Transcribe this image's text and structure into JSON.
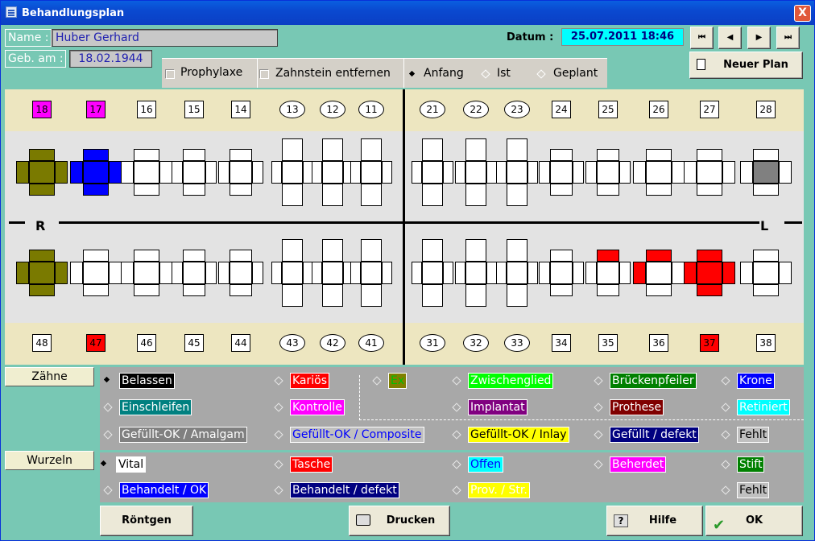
{
  "window": {
    "title": "Behandlungsplan",
    "close": "X"
  },
  "patient": {
    "name_label": "Name :",
    "name": "Huber Gerhard",
    "dob_label": "Geb. am :",
    "dob": "18.02.1944"
  },
  "datum": {
    "label": "Datum :",
    "value": "25.07.2011 18:46"
  },
  "nav": {
    "first": "⏮",
    "prev": "◀",
    "next": "▶",
    "last": "⏭"
  },
  "new_plan": "Neuer Plan",
  "options": {
    "prophylaxe": "Prophylaxe",
    "zahnstein": "Zahnstein entfernen",
    "anfang": "Anfang",
    "ist": "Ist",
    "geplant": "Geplant",
    "selected": "Anfang"
  },
  "side": {
    "r": "R",
    "l": "L"
  },
  "teeth_upper": [
    "18",
    "17",
    "16",
    "15",
    "14",
    "13",
    "12",
    "11",
    "21",
    "22",
    "23",
    "24",
    "25",
    "26",
    "27",
    "28"
  ],
  "teeth_lower": [
    "48",
    "47",
    "46",
    "45",
    "44",
    "43",
    "42",
    "41",
    "31",
    "32",
    "33",
    "34",
    "35",
    "36",
    "37",
    "38"
  ],
  "colors": {
    "olive": "#7a7a00",
    "blue": "#0000ff",
    "red": "#ff0000",
    "magenta": "#ff00ff",
    "gray": "#808080"
  },
  "buttons": {
    "zaehne": "Zähne",
    "wurzeln": "Wurzeln",
    "roentgen": "Röntgen",
    "drucken": "Drucken",
    "hilfe": "Hilfe",
    "ok": "OK"
  },
  "legend_teeth": [
    {
      "label": "Belassen",
      "bg": "#000000",
      "fg": "#ffffff",
      "on": true
    },
    {
      "label": "Kariös",
      "bg": "#ff0000",
      "fg": "#ffffff"
    },
    {
      "label": "Ex",
      "bg": "#808000",
      "fg": "#00c000"
    },
    {
      "label": "Zwischenglied",
      "bg": "#00ff00",
      "fg": "#ffffff"
    },
    {
      "label": "Brückenpfeiler",
      "bg": "#008000",
      "fg": "#ffffff"
    },
    {
      "label": "Krone",
      "bg": "#0000ff",
      "fg": "#ffffff"
    },
    {
      "label": "Einschleifen",
      "bg": "#008080",
      "fg": "#ffffff"
    },
    {
      "label": "Kontrolle",
      "bg": "#ff00ff",
      "fg": "#ffffff"
    },
    {
      "label": "Implantat",
      "bg": "#800080",
      "fg": "#ffffff"
    },
    {
      "label": "Prothese",
      "bg": "#800000",
      "fg": "#ffffff"
    },
    {
      "label": "Retiniert",
      "bg": "#00ffff",
      "fg": "#ffffff"
    },
    {
      "label": "Gefüllt-OK / Amalgam",
      "bg": "#808080",
      "fg": "#ffffff"
    },
    {
      "label": "Gefüllt-OK / Composite",
      "bg": "#c0c0c0",
      "fg": "#0000ff"
    },
    {
      "label": "Gefüllt-OK / Inlay",
      "bg": "#ffff00",
      "fg": "#000000"
    },
    {
      "label": "Gefüllt / defekt",
      "bg": "#000080",
      "fg": "#ffffff"
    },
    {
      "label": "Fehlt",
      "bg": "#c0c0c0",
      "fg": "#000000"
    }
  ],
  "legend_roots": [
    {
      "label": "Vital",
      "bg": "#ffffff",
      "fg": "#000000",
      "on": true
    },
    {
      "label": "Tasche",
      "bg": "#ff0000",
      "fg": "#ffffff"
    },
    {
      "label": "Offen",
      "bg": "#00ffff",
      "fg": "#0000ff"
    },
    {
      "label": "Beherdet",
      "bg": "#ff00ff",
      "fg": "#ffffff"
    },
    {
      "label": "Stift",
      "bg": "#008000",
      "fg": "#ffffff"
    },
    {
      "label": "Behandelt / OK",
      "bg": "#0000ff",
      "fg": "#ffffff"
    },
    {
      "label": "Behandelt / defekt",
      "bg": "#000080",
      "fg": "#ffffff"
    },
    {
      "label": "Prov. / Str.",
      "bg": "#ffff00",
      "fg": "#ffffff"
    },
    {
      "label": "Fehlt",
      "bg": "#c0c0c0",
      "fg": "#000000"
    }
  ]
}
